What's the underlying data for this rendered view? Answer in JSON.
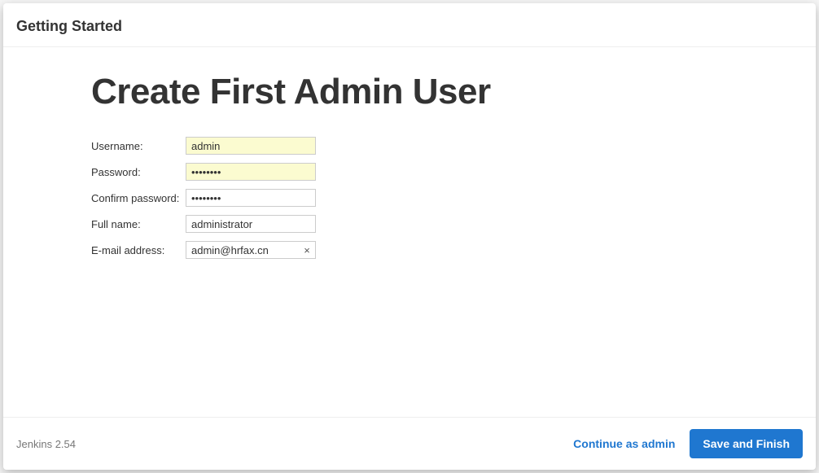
{
  "header": {
    "title": "Getting Started"
  },
  "page": {
    "heading": "Create First Admin User"
  },
  "form": {
    "username": {
      "label": "Username:",
      "value": "admin"
    },
    "password": {
      "label": "Password:",
      "value": "••••••••"
    },
    "confirm": {
      "label": "Confirm password:",
      "value": "••••••••"
    },
    "fullname": {
      "label": "Full name:",
      "value": "administrator"
    },
    "email": {
      "label": "E-mail address:",
      "value": "admin@hrfax.cn"
    }
  },
  "footer": {
    "version": "Jenkins 2.54",
    "continue_label": "Continue as admin",
    "save_label": "Save and Finish"
  }
}
